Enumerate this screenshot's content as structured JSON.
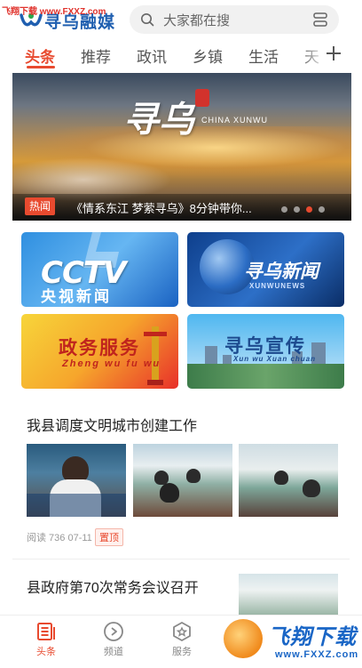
{
  "watermark_top": "飞翔下载 www.FXXZ.com",
  "header": {
    "logo_text": "寻乌融媒",
    "search_placeholder": "大家都在搜",
    "scan_icon": "scan-icon"
  },
  "tabs": [
    {
      "label": "头条",
      "active": true
    },
    {
      "label": "推荐",
      "active": false
    },
    {
      "label": "政讯",
      "active": false
    },
    {
      "label": "乡镇",
      "active": false
    },
    {
      "label": "生活",
      "active": false
    },
    {
      "label": "天",
      "active": false
    }
  ],
  "banner": {
    "title": "寻乌",
    "seal": "中国",
    "subtitle_en": "CHINA XUNWU",
    "badge": "热闻",
    "caption": "《情系东江 梦萦寻乌》8分钟带你...",
    "dots_total": 4,
    "active_dot": 3
  },
  "cards": {
    "cctv": {
      "logo": "CCTV",
      "label": "央视新闻"
    },
    "news": {
      "label": "寻乌新闻",
      "en": "XUNWUNEWS"
    },
    "gov": {
      "label": "政务服务",
      "pinyin": "Zheng  wu  fu  wu"
    },
    "promo": {
      "label": "寻乌宣传",
      "pinyin": "Xun  wu  Xuan  chuan"
    }
  },
  "article1": {
    "title": "我县调度文明城市创建工作",
    "meta": "阅读 736  07-11",
    "badge": "置顶"
  },
  "article2": {
    "title": "县政府第70次常务会议召开"
  },
  "bottom_nav": [
    {
      "label": "头条",
      "icon": "news-icon",
      "active": true
    },
    {
      "label": "频道",
      "icon": "play-icon",
      "active": false
    },
    {
      "label": "服务",
      "icon": "service-icon",
      "active": false
    }
  ],
  "watermark_br": {
    "cn": "飞翔下载",
    "url": "www.FXXZ.com"
  },
  "colors": {
    "accent": "#e84a2f",
    "logo_blue": "#1f5fb0"
  }
}
